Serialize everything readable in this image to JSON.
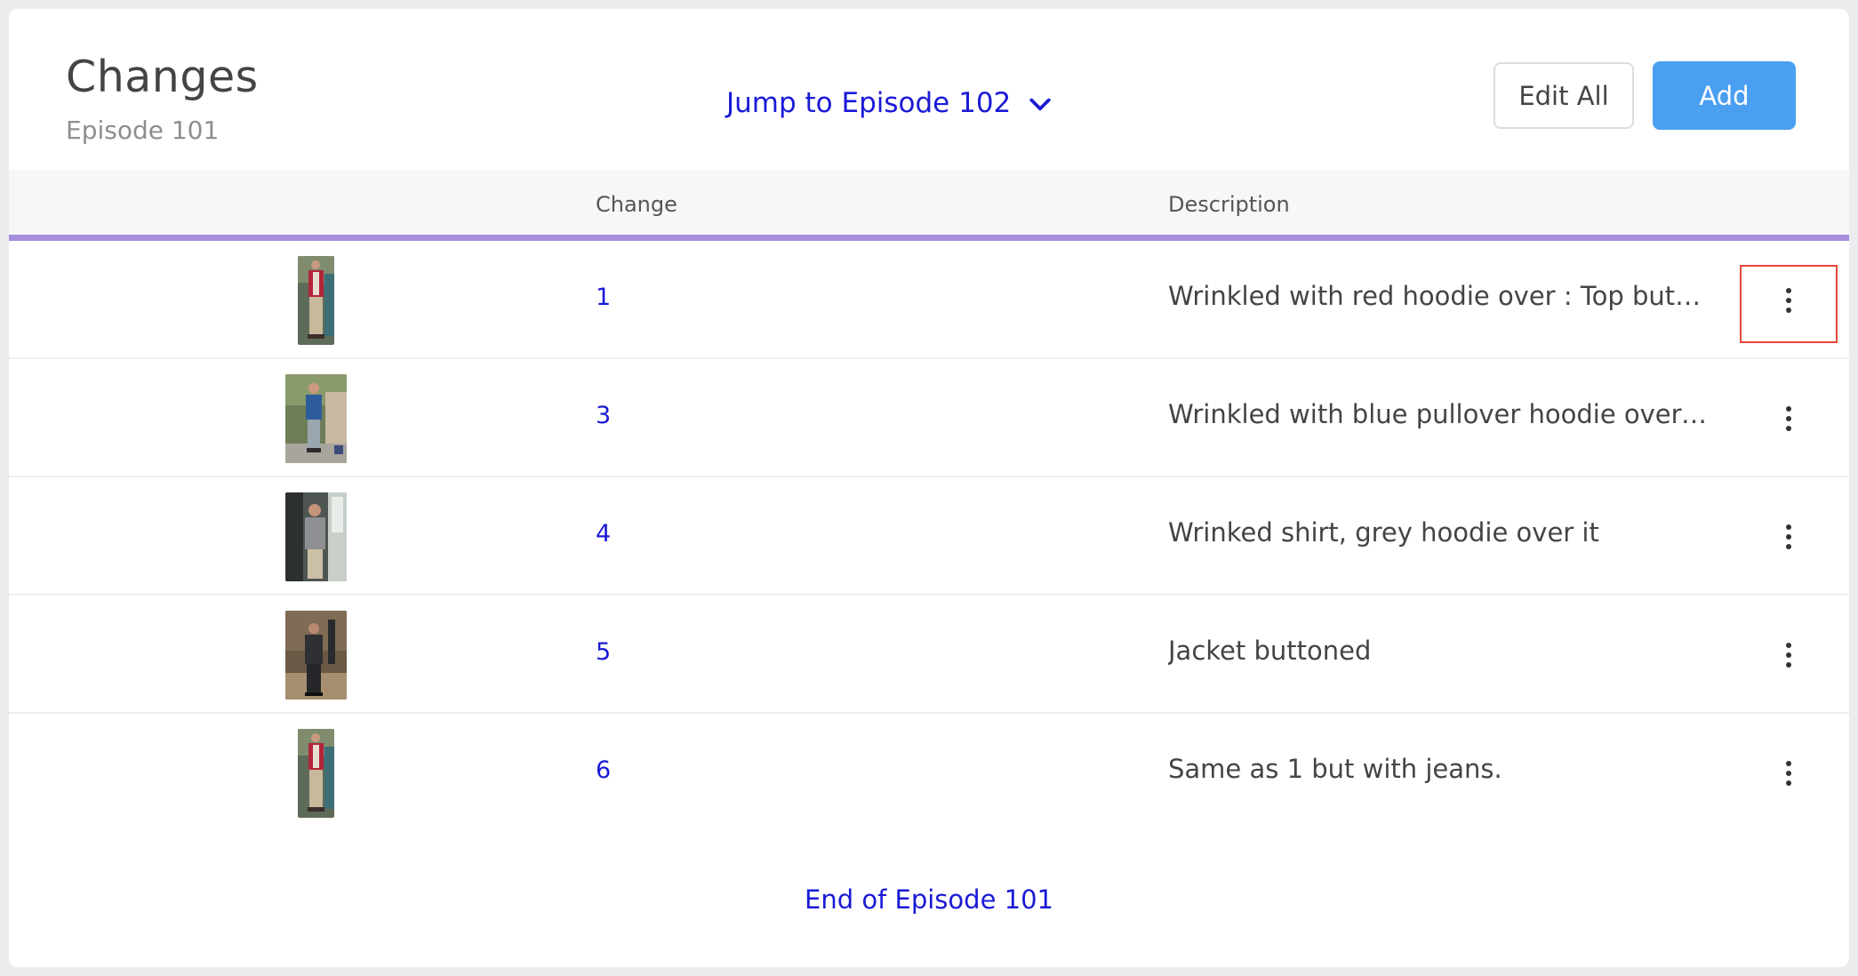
{
  "header": {
    "title": "Changes",
    "subtitle": "Episode 101",
    "jump_label": "Jump to Episode 102",
    "edit_all_label": "Edit All",
    "add_label": "Add"
  },
  "table": {
    "columns": [
      "",
      "Change",
      "Description"
    ],
    "rows": [
      {
        "number": "1",
        "description": "Wrinkled with red hoodie over : Top button u...",
        "thumb": "red-hoodie-thumbnail"
      },
      {
        "number": "3",
        "description": "Wrinkled with blue pullover hoodie over: top...",
        "thumb": "blue-hoodie-thumbnail"
      },
      {
        "number": "4",
        "description": "Wrinked shirt, grey hoodie over it",
        "thumb": "grey-hoodie-thumbnail"
      },
      {
        "number": "5",
        "description": "Jacket buttoned",
        "thumb": "jacket-thumbnail"
      },
      {
        "number": "6",
        "description": "Same as 1 but with jeans.",
        "thumb": "red-hoodie-jeans-thumbnail"
      }
    ]
  },
  "footer": {
    "end_label": "End of Episode 101"
  },
  "colors": {
    "accent": "#4a9ff0",
    "link": "#1a1ad6",
    "divider": "#a88fdc",
    "highlight": "#e8483a"
  }
}
